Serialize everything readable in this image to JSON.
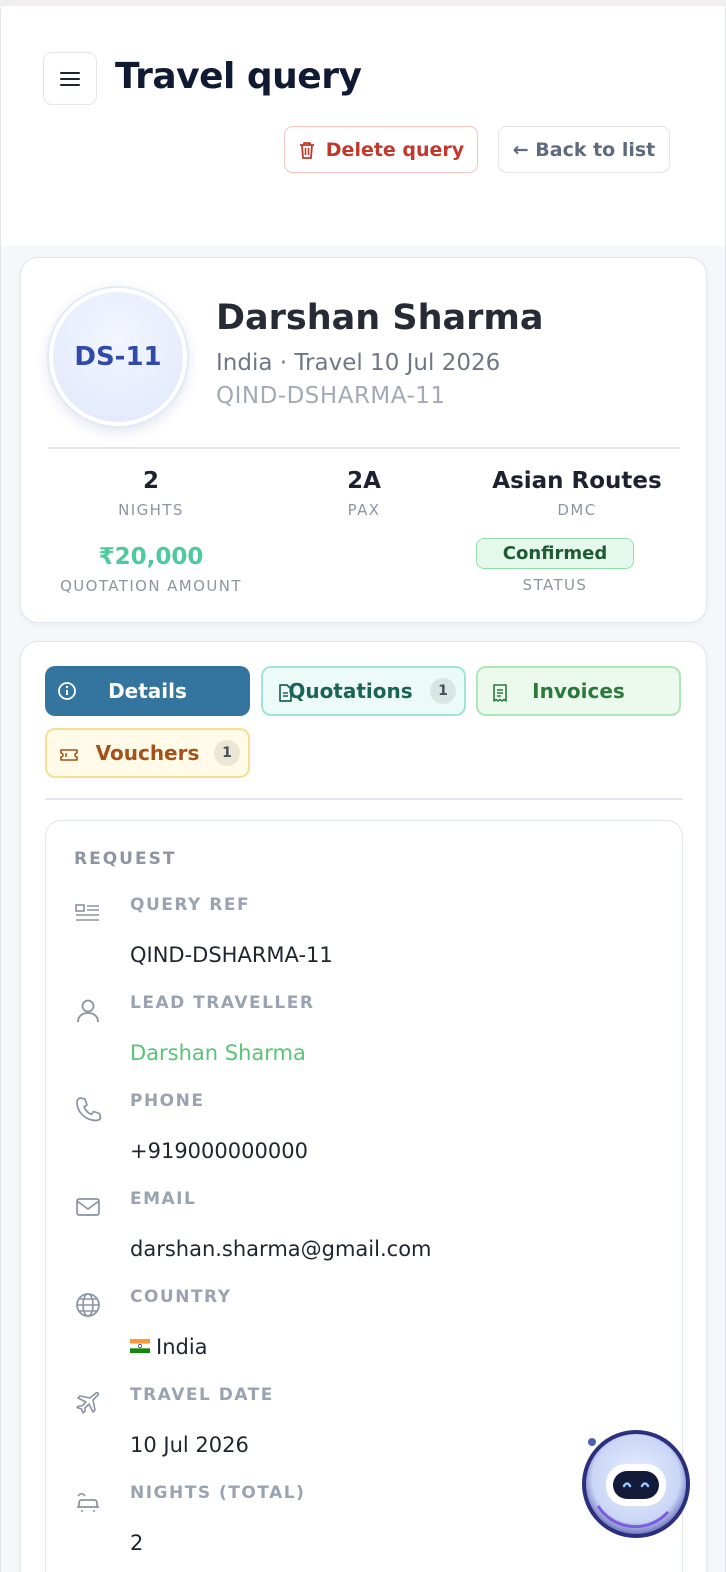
{
  "header": {
    "title": "Travel query",
    "menu_icon": "hamburger-icon",
    "delete_label": "Delete query",
    "back_label": "← Back to list"
  },
  "profile": {
    "initials": "DS-11",
    "name": "Darshan Sharma",
    "subtitle": "India · Travel 10 Jul 2026",
    "ref": "QIND-DSHARMA-11",
    "stats": {
      "nights_value": "2",
      "nights_label": "NIGHTS",
      "pax_value": "2A",
      "pax_label": "PAX",
      "dmc_value": "Asian Routes",
      "dmc_label": "DMC",
      "amount_value": "₹20,000",
      "amount_label": "QUOTATION AMOUNT",
      "status_value": "Confirmed",
      "status_label": "STATUS"
    }
  },
  "tabs": [
    {
      "label": "Details",
      "icon": "info-icon",
      "active": true
    },
    {
      "label": "Quotations",
      "icon": "document-icon",
      "count": "1"
    },
    {
      "label": "Invoices",
      "icon": "receipt-icon"
    },
    {
      "label": "Vouchers",
      "icon": "ticket-icon",
      "count": "1"
    }
  ],
  "request": {
    "section_title": "REQUEST",
    "fields": [
      {
        "label": "QUERY REF",
        "value": "QIND-DSHARMA-11",
        "icon": "ref-list-icon"
      },
      {
        "label": "LEAD TRAVELLER",
        "value": "Darshan Sharma",
        "icon": "user-icon"
      },
      {
        "label": "PHONE",
        "value": "+919000000000",
        "icon": "phone-icon"
      },
      {
        "label": "EMAIL",
        "value": "darshan.sharma@gmail.com",
        "icon": "mail-icon"
      },
      {
        "label": "COUNTRY",
        "value": "India",
        "icon": "globe-icon",
        "flag": "india-flag"
      },
      {
        "label": "TRAVEL DATE",
        "value": "10 Jul 2026",
        "icon": "plane-icon"
      },
      {
        "label": "NIGHTS (TOTAL)",
        "value": "2",
        "icon": "bed-icon"
      }
    ]
  },
  "colors": {
    "primary_tab": "#34759f",
    "amount": "#4ecb9c",
    "status_bg": "#e5f8ec",
    "danger": "#c0392b",
    "link": "#58c476"
  },
  "assistant": {
    "icon": "chatbot-avatar-icon"
  }
}
